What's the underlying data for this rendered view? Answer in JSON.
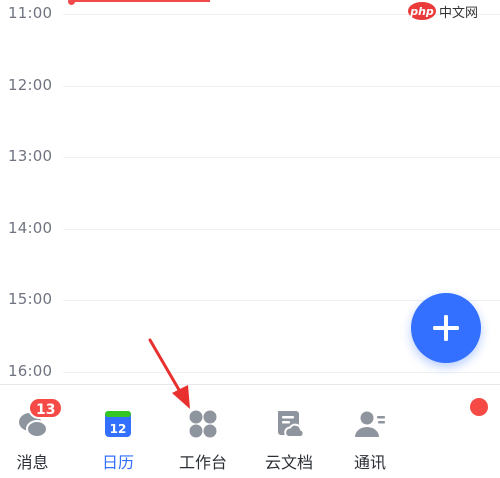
{
  "calendar": {
    "hours": [
      "11:00",
      "12:00",
      "13:00",
      "14:00",
      "15:00",
      "16:00"
    ]
  },
  "watermark": {
    "badge": "php",
    "text": "中文网"
  },
  "fab": {
    "icon": "plus-icon"
  },
  "tabbar": {
    "tabs": [
      {
        "label": "消息",
        "icon": "chat-bubbles-icon",
        "badge": "13"
      },
      {
        "label": "日历",
        "icon": "calendar-icon",
        "day": "12",
        "active": true
      },
      {
        "label": "工作台",
        "icon": "workspace-grid-icon"
      },
      {
        "label": "云文档",
        "icon": "cloud-doc-icon"
      },
      {
        "label": "通讯",
        "icon": "contacts-icon"
      }
    ]
  },
  "colors": {
    "accent": "#3370ff",
    "badge": "#f54a45",
    "now_line": "#f04a4a",
    "annotation_arrow": "#e8312f"
  }
}
